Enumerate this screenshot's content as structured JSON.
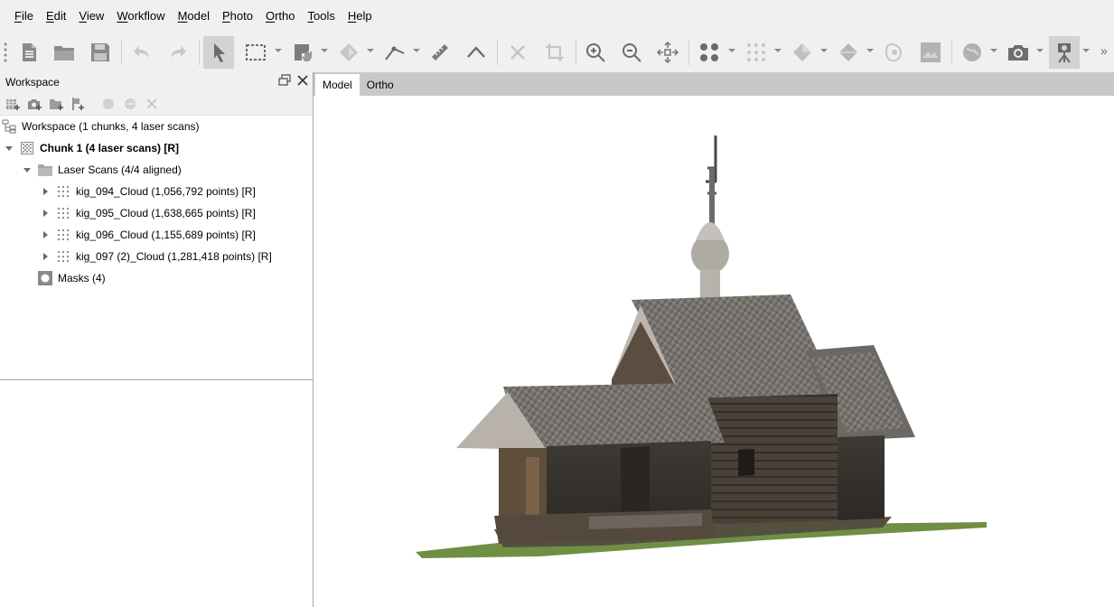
{
  "menu": [
    {
      "accel": "F",
      "rest": "ile"
    },
    {
      "accel": "E",
      "rest": "dit"
    },
    {
      "accel": "V",
      "rest": "iew"
    },
    {
      "accel": "W",
      "rest": "orkflow"
    },
    {
      "accel": "M",
      "rest": "odel"
    },
    {
      "accel": "P",
      "rest": "hoto"
    },
    {
      "accel": "O",
      "rest": "rtho"
    },
    {
      "accel": "T",
      "rest": "ools"
    },
    {
      "accel": "H",
      "rest": "elp"
    }
  ],
  "toolbar": {
    "overflow_label": "»",
    "icons": [
      "new-document-icon",
      "open-folder-icon",
      "save-icon",
      "undo-icon",
      "redo-icon",
      "select-pointer-icon",
      "rectangle-selection-icon",
      "navigation-mode-icon",
      "shape-drawing-icon",
      "ruler-icon",
      "polyline-icon",
      "delete-icon",
      "crop-icon",
      "zoom-in-icon",
      "zoom-out-icon",
      "reset-view-icon",
      "point-cloud-icon",
      "point-size-icon",
      "model-shaded-icon",
      "model-textured-icon",
      "tiled-model-icon",
      "texture-icon",
      "globe-icon",
      "camera-icon",
      "laser-scanner-icon"
    ]
  },
  "workspace": {
    "title": "Workspace",
    "root": "Workspace (1 chunks, 4 laser scans)",
    "chunk": "Chunk 1 (4 laser scans) [R]",
    "folder": "Laser Scans (4/4 aligned)",
    "scans": [
      "kig_094_Cloud (1,056,792 points) [R]",
      "kig_095_Cloud (1,638,665 points) [R]",
      "kig_096_Cloud (1,155,689 points) [R]",
      "kig_097 (2)_Cloud (1,281,418 points) [R]"
    ],
    "masks": "Masks (4)"
  },
  "tabs": {
    "model": "Model",
    "ortho": "Ortho"
  },
  "colors": {
    "chrome": "#f0f0f0",
    "tab_strip": "#c8c8c8",
    "roof": "#7e7a75",
    "wood": "#4f463c",
    "grass": "#6f8f45"
  }
}
